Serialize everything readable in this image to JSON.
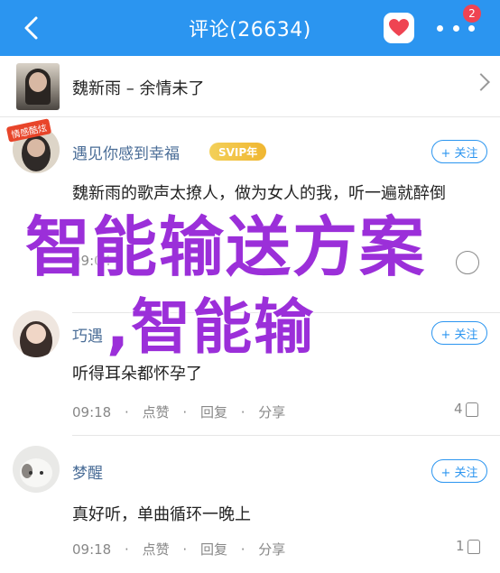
{
  "header": {
    "title": "评论(26634)",
    "notification_count": "2",
    "accent": "#2b95f0"
  },
  "song": {
    "title": "魏新雨 – 余情未了"
  },
  "comments": [
    {
      "user": "遇见你感到幸福",
      "badge": "SVIP年",
      "follow": "+ 关注",
      "text": "魏新雨的歌声太撩人，做为女人的我，听一遍就醉倒",
      "meta_time": "09:04",
      "meta_like": "",
      "meta_reply": "",
      "meta_share": "",
      "likes": "",
      "avatar_tag": "情感酷炫"
    },
    {
      "user": "巧遇",
      "follow": "+ 关注",
      "text": "听得耳朵都怀孕了",
      "meta_time": "09:18",
      "meta_like": "点赞",
      "meta_reply": "回复",
      "meta_share": "分享",
      "likes": "4"
    },
    {
      "user": "梦醒",
      "follow": "+ 关注",
      "text": "真好听，单曲循环一晚上",
      "meta_time": "09:18",
      "meta_like": "点赞",
      "meta_reply": "回复",
      "meta_share": "分享",
      "likes": "1"
    }
  ],
  "watermark": {
    "line1": "智能输送方案",
    "line2": ",智能输",
    "color": "#9b2fd9"
  }
}
